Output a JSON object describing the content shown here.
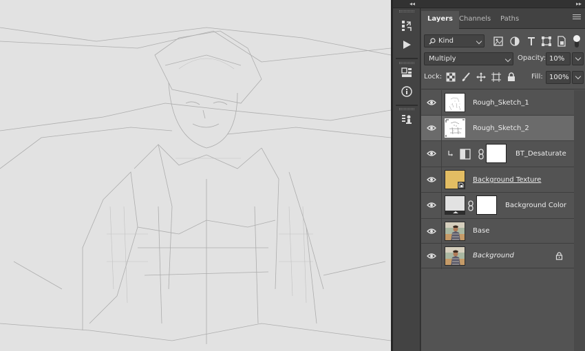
{
  "app": {
    "collapse_left": "◂◂",
    "collapse_right": "▸▸"
  },
  "panel": {
    "tabs": [
      {
        "label": "Layers",
        "active": true
      },
      {
        "label": "Channels",
        "active": false
      },
      {
        "label": "Paths",
        "active": false
      }
    ],
    "filter": {
      "kind_label": "Kind"
    },
    "blend_mode": "Multiply",
    "opacity_label": "Opacity:",
    "opacity_value": "10%",
    "lock_label": "Lock:",
    "fill_label": "Fill:",
    "fill_value": "100%"
  },
  "tools": [
    {
      "icon": "history-brush-icon"
    },
    {
      "icon": "play-action-icon"
    },
    {
      "icon": "libraries-icon"
    },
    {
      "icon": "info-icon"
    },
    {
      "icon": "properties-icon"
    }
  ],
  "layers": [
    {
      "name": "Rough_Sketch_1",
      "selected": false,
      "kind": "sketch"
    },
    {
      "name": "Rough_Sketch_2",
      "selected": true,
      "kind": "sketch"
    },
    {
      "name": "BT_Desaturate",
      "selected": false,
      "kind": "adjustment"
    },
    {
      "name": "Background Texture",
      "selected": false,
      "kind": "smart-object",
      "underline": true
    },
    {
      "name": "Background Color",
      "selected": false,
      "kind": "fill"
    },
    {
      "name": "Base",
      "selected": false,
      "kind": "photo"
    },
    {
      "name": "Background",
      "selected": false,
      "kind": "photo",
      "italic": true,
      "locked": true
    }
  ],
  "colors": {
    "texture_swatch": "#e3bd63",
    "fill_swatch": "#e2e2e2",
    "selection": "#6b6b6b"
  }
}
